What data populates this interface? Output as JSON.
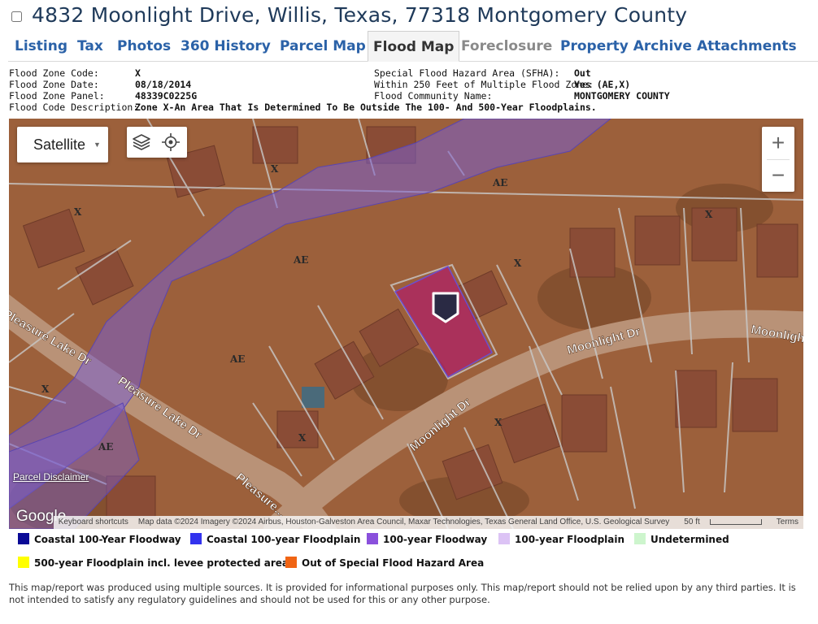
{
  "header": {
    "checked": false,
    "title": "4832 Moonlight Drive, Willis, Texas, 77318 Montgomery County"
  },
  "tabs": [
    {
      "label": "Listing"
    },
    {
      "label": "Tax"
    },
    {
      "label": "Photos"
    },
    {
      "label": "360 History"
    },
    {
      "label": "Parcel Map"
    },
    {
      "label": "Flood Map",
      "state": "active"
    },
    {
      "label": "Foreclosure",
      "state": "disabled"
    },
    {
      "label": "Property Archive"
    },
    {
      "label": "Attachments"
    }
  ],
  "flood_info": {
    "zone_code_label": "Flood Zone Code:",
    "zone_code": "X",
    "zone_date_label": "Flood Zone Date:",
    "zone_date": "08/18/2014",
    "zone_panel_label": "Flood Zone Panel:",
    "zone_panel": "48339C0225G",
    "description_label": "Flood Code Description:",
    "description": "Zone X-An Area That Is Determined To Be Outside The 100- And 500-Year Floodplains.",
    "sfha_label": "Special Flood Hazard Area (SFHA):",
    "sfha": "Out",
    "within_label": "Within 250 Feet of Multiple Flood Zone:",
    "within": "Yes (AE,X)",
    "community_label": "Flood Community Name:",
    "community": "MONTGOMERY COUNTY"
  },
  "map": {
    "type_selector": "Satellite",
    "zoom_in": "+",
    "zoom_out": "−",
    "parcel_disclaimer": "Parcel Disclaimer",
    "google_logo": "Google",
    "keyboard_shortcuts": "Keyboard shortcuts",
    "map_data": "Map data ©2024 Imagery ©2024 Airbus, Houston-Galveston Area Council, Maxar Technologies, Texas General Land Office, U.S. Geological Survey",
    "scale": "50 ft",
    "terms": "Terms",
    "zone_labels": [
      "AE",
      "AE",
      "AE",
      "AE",
      "X",
      "X",
      "X",
      "X",
      "X",
      "X",
      "X"
    ],
    "street_labels": [
      "Moonlight Dr",
      "Moonlight Dr",
      "Moonlight Dr",
      "Pleasure Lake Dr",
      "Pleasure Lake Dr",
      "Pleasure..."
    ],
    "colors": {
      "floodway": "#7a5fd0",
      "parcel": "#b01e6a"
    }
  },
  "legend": [
    {
      "label": "Coastal 100-Year Floodway",
      "color": "#0a0a96"
    },
    {
      "label": "Coastal 100-year Floodplain",
      "color": "#3333ee"
    },
    {
      "label": "100-year Floodway",
      "color": "#8a50dc"
    },
    {
      "label": "100-year Floodplain",
      "color": "#dcc3f5"
    },
    {
      "label": "Undetermined",
      "color": "#cdf5cd"
    },
    {
      "label": "500-year Floodplain incl. levee protected area",
      "color": "#ffff00"
    },
    {
      "label": "Out of Special Flood Hazard Area",
      "color": "#f06414"
    }
  ],
  "footer": "This map/report was produced using multiple sources. It is provided for informational purposes only. This map/report should not be relied upon by any third parties. It is not intended to satisfy any regulatory guidelines and should not be used for this or any other purpose."
}
